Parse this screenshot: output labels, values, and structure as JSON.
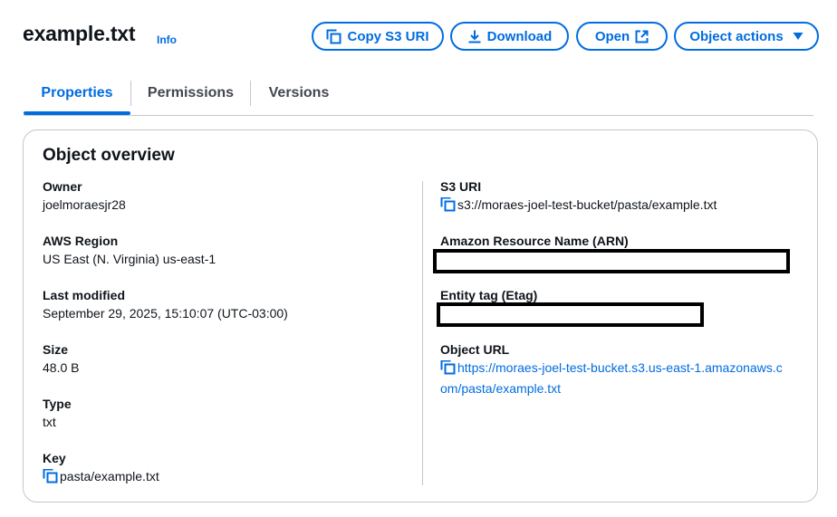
{
  "header": {
    "title": "example.txt",
    "info_label": "Info",
    "buttons": {
      "copy_s3_uri": "Copy S3 URI",
      "download": "Download",
      "open": "Open",
      "object_actions": "Object actions"
    }
  },
  "tabs": [
    {
      "label": "Properties",
      "active": true
    },
    {
      "label": "Permissions",
      "active": false
    },
    {
      "label": "Versions",
      "active": false
    }
  ],
  "overview": {
    "title": "Object overview",
    "left": [
      {
        "label": "Owner",
        "value": "joelmoraesjr28"
      },
      {
        "label": "AWS Region",
        "value": "US East (N. Virginia) us-east-1"
      },
      {
        "label": "Last modified",
        "value": "September 29, 2025, 15:10:07 (UTC-03:00)"
      },
      {
        "label": "Size",
        "value": "48.0 B"
      },
      {
        "label": "Type",
        "value": "txt"
      },
      {
        "label": "Key",
        "value": "pasta/example.txt"
      }
    ],
    "right": [
      {
        "label": "S3 URI",
        "value": "s3://moraes-joel-test-bucket/pasta/example.txt"
      },
      {
        "label": "Amazon Resource Name (ARN)",
        "value": ""
      },
      {
        "label": "Entity tag (Etag)",
        "value": ""
      },
      {
        "label": "Object URL",
        "value_line1": "https://moraes-joel-test-bucket.s3.us-east-1.amazonaws.c",
        "value_line2": "om/pasta/example.txt"
      }
    ]
  },
  "colors": {
    "accent": "#006ce0",
    "text": "#0f141a",
    "border": "#c6c6cd"
  },
  "icons": [
    "copy-icon",
    "download-icon",
    "external-link-icon",
    "caret-down-icon"
  ]
}
